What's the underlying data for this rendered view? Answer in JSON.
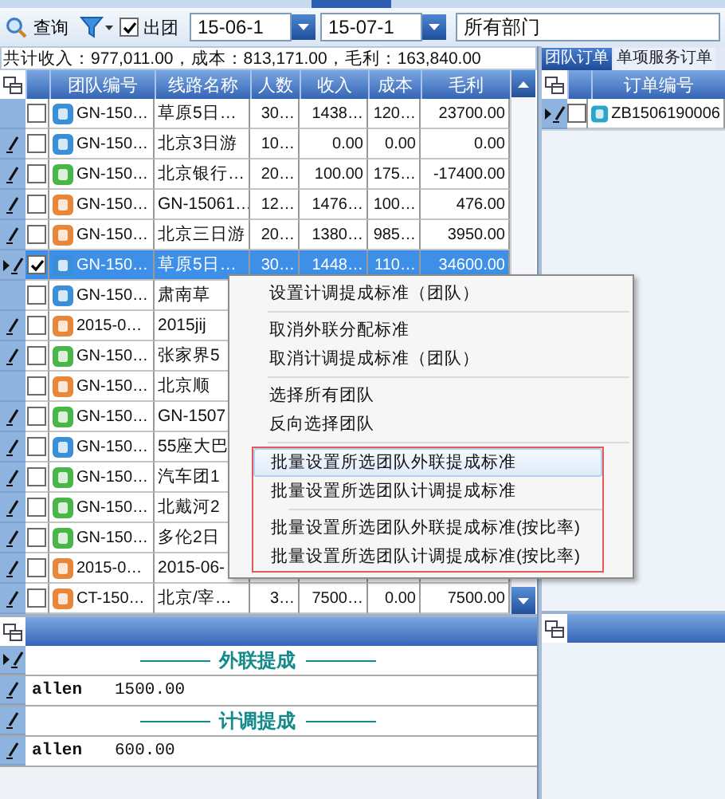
{
  "toolbar": {
    "query_label": "查询",
    "depart_checked": true,
    "depart_label": "出团",
    "date_from": "15-06-1",
    "date_to": "15-07-1",
    "department": "所有部门"
  },
  "summary": "共计收入：977,011.00，成本：813,171.00，毛利：163,840.00",
  "groups_table": {
    "columns": [
      "团队编号",
      "线路名称",
      "人数",
      "收入",
      "成本",
      "毛利"
    ],
    "rows": [
      {
        "current": false,
        "edited": false,
        "selected": false,
        "checked": false,
        "color": "#3a8fd8",
        "code": "GN-150…",
        "route": "草原5日…",
        "count": "30…",
        "income": "1438…",
        "cost": "120…",
        "profit": "23700.00"
      },
      {
        "current": false,
        "edited": true,
        "selected": false,
        "checked": false,
        "color": "#3a8fd8",
        "code": "GN-150…",
        "route": "北京3日游",
        "count": "10…",
        "income": "0.00",
        "cost": "0.00",
        "profit": "0.00"
      },
      {
        "current": false,
        "edited": true,
        "selected": false,
        "checked": false,
        "color": "#49b649",
        "code": "GN-150…",
        "route": "北京银行…",
        "count": "20…",
        "income": "100.00",
        "cost": "175…",
        "profit": "-17400.00"
      },
      {
        "current": false,
        "edited": true,
        "selected": false,
        "checked": false,
        "color": "#e8863a",
        "code": "GN-150…",
        "route": "GN-15061…",
        "count": "12…",
        "income": "1476…",
        "cost": "100…",
        "profit": "476.00"
      },
      {
        "current": false,
        "edited": true,
        "selected": false,
        "checked": false,
        "color": "#e8863a",
        "code": "GN-150…",
        "route": "北京三日游",
        "count": "20…",
        "income": "1380…",
        "cost": "985…",
        "profit": "3950.00"
      },
      {
        "current": true,
        "edited": true,
        "selected": true,
        "checked": true,
        "color": "#3a8fd8",
        "code": "GN-150…",
        "route": "草原5日…",
        "count": "30…",
        "income": "1448…",
        "cost": "110…",
        "profit": "34600.00"
      },
      {
        "current": false,
        "edited": false,
        "selected": false,
        "checked": false,
        "color": "#3a8fd8",
        "code": "GN-150…",
        "route": "肃南草"
      },
      {
        "current": false,
        "edited": true,
        "selected": false,
        "checked": false,
        "color": "#e8863a",
        "code": "2015-0…",
        "route": "2015jij"
      },
      {
        "current": false,
        "edited": true,
        "selected": false,
        "checked": false,
        "color": "#49b649",
        "code": "GN-150…",
        "route": "张家界5"
      },
      {
        "current": false,
        "edited": false,
        "selected": false,
        "checked": false,
        "color": "#e8863a",
        "code": "GN-150…",
        "route": "北京顺"
      },
      {
        "current": false,
        "edited": true,
        "selected": false,
        "checked": false,
        "color": "#49b649",
        "code": "GN-150…",
        "route": "GN-1507"
      },
      {
        "current": false,
        "edited": true,
        "selected": false,
        "checked": false,
        "color": "#3a8fd8",
        "code": "GN-150…",
        "route": "55座大巴"
      },
      {
        "current": false,
        "edited": true,
        "selected": false,
        "checked": false,
        "color": "#49b649",
        "code": "GN-150…",
        "route": "汽车团1"
      },
      {
        "current": false,
        "edited": true,
        "selected": false,
        "checked": false,
        "color": "#49b649",
        "code": "GN-150…",
        "route": "北戴河2"
      },
      {
        "current": false,
        "edited": true,
        "selected": false,
        "checked": false,
        "color": "#49b649",
        "code": "GN-150…",
        "route": "多伦2日"
      },
      {
        "current": false,
        "edited": true,
        "selected": false,
        "checked": false,
        "color": "#e8863a",
        "code": "2015-0…",
        "route": "2015-06-"
      },
      {
        "current": false,
        "edited": true,
        "selected": false,
        "checked": false,
        "color": "#e8863a",
        "code": "CT-150…",
        "route": "北京/宰…",
        "count": "3…",
        "income": "7500…",
        "cost": "0.00",
        "profit": "7500.00"
      }
    ]
  },
  "context_menu": {
    "sections": [
      {
        "framed": false,
        "groups": [
          [
            {
              "label": "设置计调提成标准（团队）",
              "highlighted": false
            }
          ],
          [
            {
              "label": "取消外联分配标准",
              "highlighted": false
            },
            {
              "label": "取消计调提成标准（团队）",
              "highlighted": false
            }
          ],
          [
            {
              "label": "选择所有团队",
              "highlighted": false
            },
            {
              "label": "反向选择团队",
              "highlighted": false
            }
          ]
        ]
      },
      {
        "framed": true,
        "groups": [
          [
            {
              "label": "批量设置所选团队外联提成标准",
              "highlighted": true
            },
            {
              "label": "批量设置所选团队计调提成标准",
              "highlighted": false
            }
          ],
          [
            {
              "label": "批量设置所选团队外联提成标准(按比率)",
              "highlighted": false
            },
            {
              "label": "批量设置所选团队计调提成标准(按比率)",
              "highlighted": false
            }
          ]
        ]
      }
    ]
  },
  "commission_panel": {
    "rows": [
      {
        "kind": "heading",
        "current": true,
        "edited": true,
        "title": "外联提成"
      },
      {
        "kind": "entry",
        "current": false,
        "edited": true,
        "name": "allen",
        "amount": "1500.00"
      },
      {
        "kind": "heading",
        "current": false,
        "edited": true,
        "title": "计调提成"
      },
      {
        "kind": "entry",
        "current": false,
        "edited": true,
        "name": "allen",
        "amount": "600.00"
      }
    ]
  },
  "orders_panel": {
    "tabs": [
      {
        "label": "团队订单",
        "selected": true
      },
      {
        "label": "单项服务订单",
        "selected": false
      }
    ],
    "columns": [
      "订单编号"
    ],
    "rows": [
      {
        "current": true,
        "edited": true,
        "checked": false,
        "color": "#2aa6c8",
        "order_no": "ZB1506190006"
      }
    ]
  }
}
